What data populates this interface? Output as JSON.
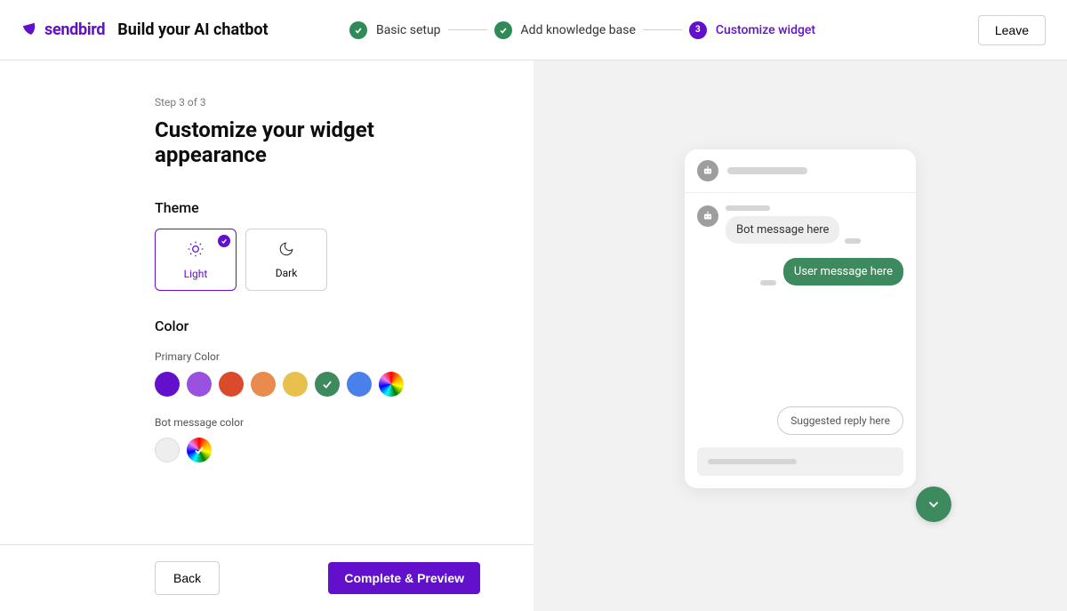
{
  "brand": {
    "name": "sendbird"
  },
  "header": {
    "title": "Build your AI chatbot",
    "leave_label": "Leave"
  },
  "steps": [
    {
      "label": "Basic setup",
      "state": "done"
    },
    {
      "label": "Add knowledge base",
      "state": "done"
    },
    {
      "number": "3",
      "label": "Customize widget",
      "state": "active"
    }
  ],
  "page": {
    "hint": "Step 3 of 3",
    "heading": "Customize your widget appearance",
    "theme_label": "Theme",
    "color_label": "Color",
    "primary_color_label": "Primary Color",
    "bot_message_color_label": "Bot message color"
  },
  "themes": {
    "light": {
      "label": "Light",
      "selected": true
    },
    "dark": {
      "label": "Dark",
      "selected": false
    }
  },
  "primary_colors": [
    {
      "hex": "#6210CC",
      "selected": false
    },
    {
      "hex": "#9b51e0",
      "selected": false
    },
    {
      "hex": "#d94b2b",
      "selected": false
    },
    {
      "hex": "#e88b4d",
      "selected": false
    },
    {
      "hex": "#e8c04d",
      "selected": false
    },
    {
      "hex": "#3c8a5e",
      "selected": true
    },
    {
      "hex": "#4a80ea",
      "selected": false
    },
    {
      "type": "rainbow",
      "selected": false
    }
  ],
  "bot_message_colors": [
    {
      "type": "light-gray",
      "selected": false
    },
    {
      "type": "rainbow",
      "selected": true
    }
  ],
  "preview": {
    "bot_message": "Bot message here",
    "user_message": "User message here",
    "suggested_reply": "Suggested reply here"
  },
  "footer": {
    "back_label": "Back",
    "primary_label": "Complete & Preview"
  }
}
